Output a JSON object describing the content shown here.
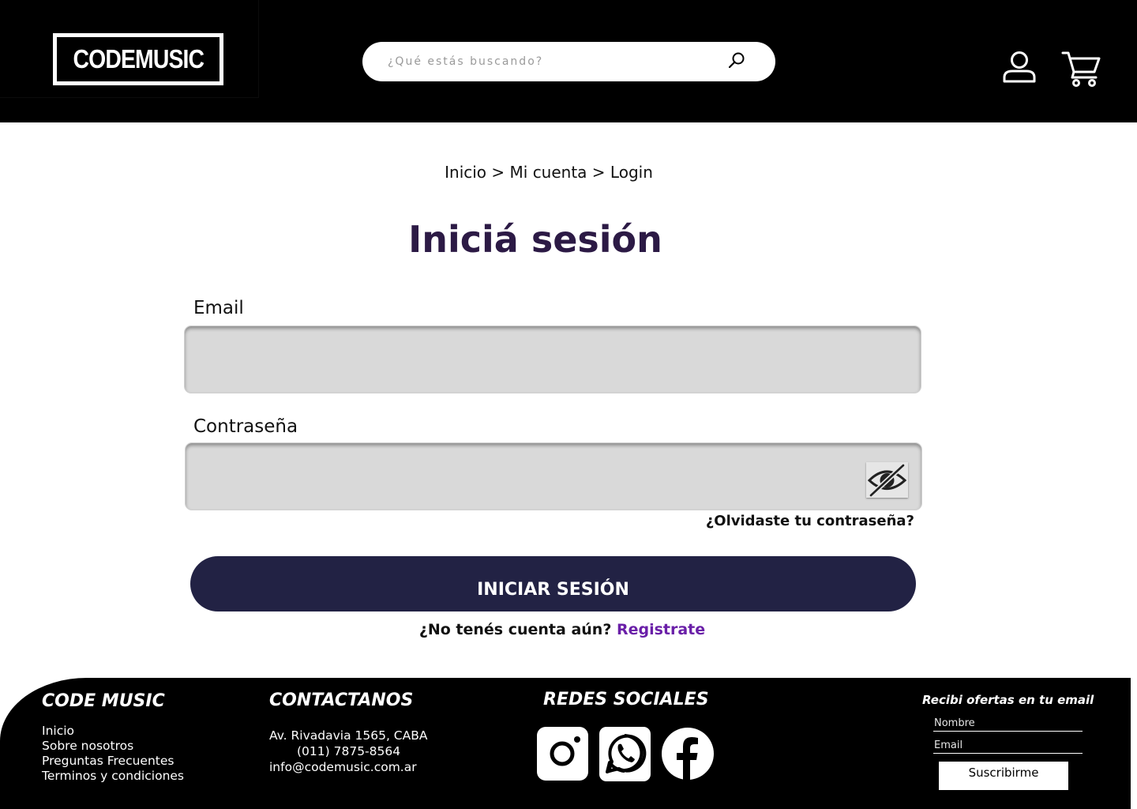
{
  "header": {
    "logo_text": "CODEMUSIC",
    "search_placeholder": "¿Qué estás buscando?",
    "icons": [
      "search-icon",
      "user-icon",
      "cart-icon"
    ]
  },
  "breadcrumb": "Inicio > Mi cuenta > Login",
  "login": {
    "title": "Iniciá sesión",
    "email_label": "Email",
    "email_value": "",
    "password_label": "Contraseña",
    "password_value": "",
    "toggle_icon": "eye-slash-icon",
    "forgot_link": "¿Olvidaste tu contraseña?",
    "submit_label": "INICIAR SESIÓN",
    "no_account_text": "¿No tenés cuenta aún?",
    "register_link": "Registrate"
  },
  "footer": {
    "brand": {
      "heading": "CODE MUSIC",
      "links": [
        "Inicio",
        "Sobre nosotros",
        "Preguntas Frecuentes",
        "Terminos y condiciones"
      ]
    },
    "contact": {
      "heading": "CONTACTANOS",
      "address": "Av. Rivadavia 1565, CABA",
      "phone": "(011) 7875-8564",
      "email": "info@codemusic.com.ar"
    },
    "social": {
      "heading": "REDES SOCIALES",
      "icons": [
        "instagram-icon",
        "whatsapp-icon",
        "facebook-icon"
      ]
    },
    "newsletter": {
      "heading": "Recibi ofertas en tu email",
      "name_placeholder": "Nombre",
      "email_placeholder": "Email",
      "button_label": "Suscribirme"
    }
  },
  "colors": {
    "header_bg": "#000000",
    "title": "#2c1a45",
    "button_bg": "#222244",
    "register_link": "#6a1fa8",
    "field_bg": "#d9d9d9"
  }
}
